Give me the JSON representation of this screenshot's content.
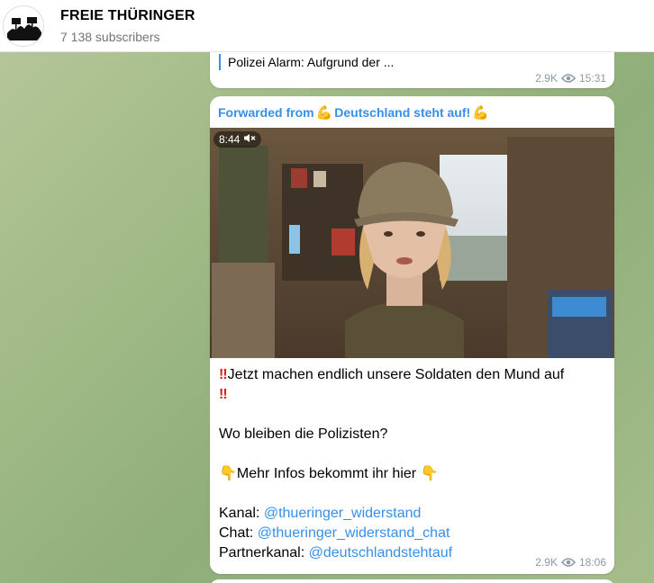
{
  "channel": {
    "title": "FREIE THÜRINGER",
    "subscribers": "7 138 subscribers"
  },
  "messages": [
    {
      "reply_preview": "Polizei Alarm: Aufgrund der ...",
      "views": "2.9K",
      "time": "15:31"
    },
    {
      "forwarded_label": "Forwarded from",
      "forwarded_source": "Deutschland steht auf!",
      "video_duration": "8:44",
      "line1": "Jetzt machen endlich unsere Soldaten den Mund auf",
      "line2": "Wo bleiben die Polizisten?",
      "line3": "Mehr Infos bekommt ihr hier",
      "kanal_label": "Kanal:",
      "kanal_link": "@thueringer_widerstand",
      "chat_label": "Chat:",
      "chat_link": "@thueringer_widerstand_chat",
      "partner_label": "Partnerkanal:",
      "partner_link": "@deutschlandstehtauf",
      "views": "2.9K",
      "time": "18:06"
    }
  ],
  "icons": {
    "views": "eye-icon",
    "muted": "speaker-muted-icon",
    "emoji_arm": "flexed-biceps-emoji",
    "emoji_point": "pointing-down-emoji",
    "emoji_excl": "double-exclamation-emoji"
  },
  "colors": {
    "link": "#3390ec",
    "meta": "#8a9aa6",
    "exclamation": "#e21c1c"
  }
}
